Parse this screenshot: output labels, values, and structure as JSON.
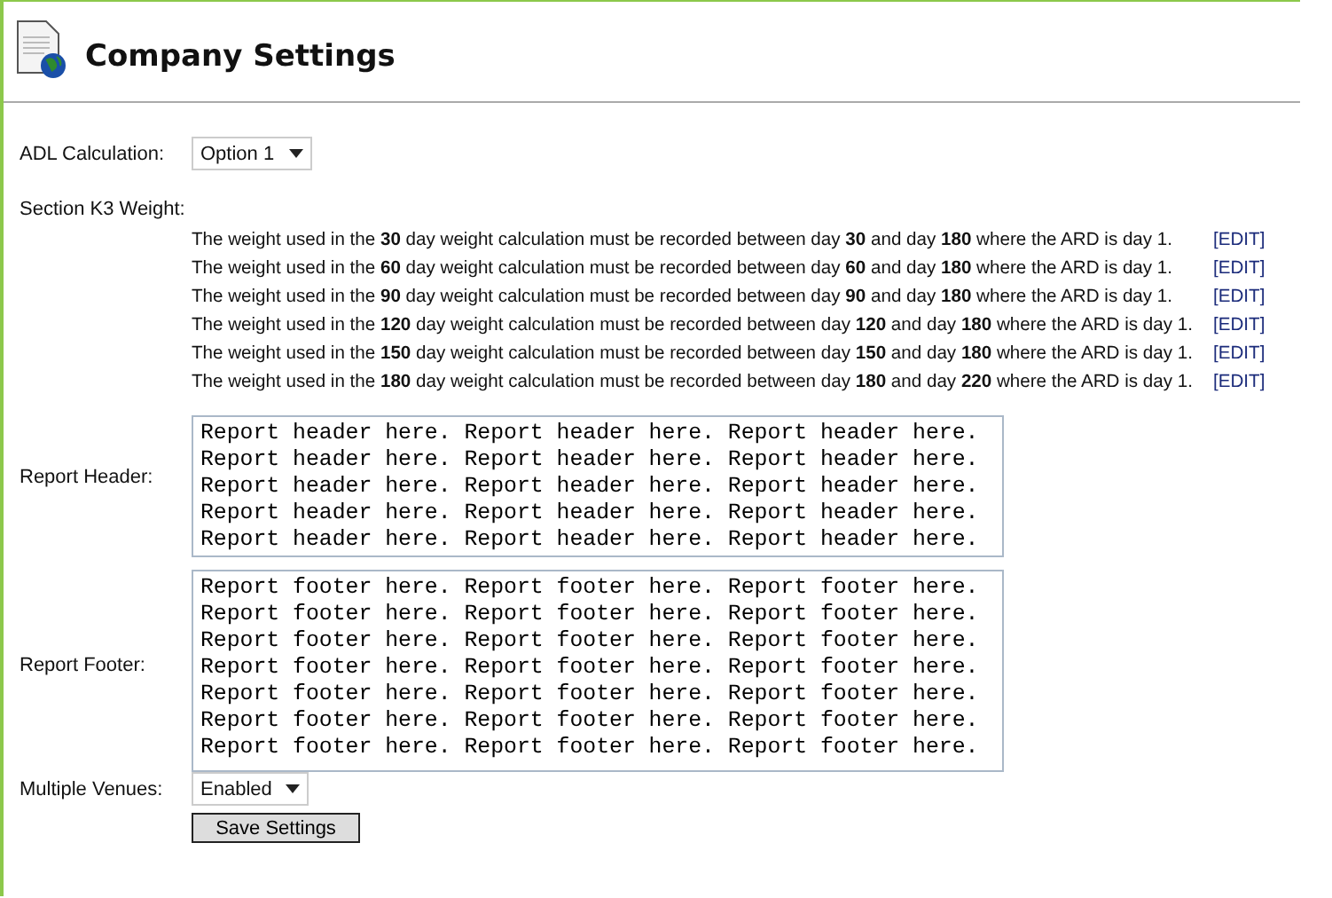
{
  "page": {
    "title": "Company Settings"
  },
  "adl_calculation": {
    "label": "ADL Calculation:",
    "value": "Option 1"
  },
  "section_k3_weight": {
    "label": "Section K3 Weight:",
    "rules": [
      {
        "text": "The weight used in the **30** day weight calculation must be recorded between day **30** and day **180** where the ARD is day 1.",
        "link": "[EDIT]"
      },
      {
        "text": "The weight used in the **60** day weight calculation must be recorded between day **60** and day **180** where the ARD is day 1.",
        "link": "[EDIT]"
      },
      {
        "text": "The weight used in the **90** day weight calculation must be recorded between day **90** and day **180** where the ARD is day 1.",
        "link": "[EDIT]"
      },
      {
        "text": "The weight used in the **120** day weight calculation must be recorded between day **120** and day **180** where the ARD is day 1.",
        "link": "[EDIT]"
      },
      {
        "text": "The weight used in the **150** day weight calculation must be recorded between day **150** and day **180** where the ARD is day 1.",
        "link": "[EDIT]"
      },
      {
        "text": "The weight used in the **180** day weight calculation must be recorded between day **180** and day **220** where the ARD is day 1.",
        "link": "[EDIT]"
      }
    ]
  },
  "report_header": {
    "label": "Report Header:",
    "value": "Report header here. Report header here. Report header here.\nReport header here. Report header here. Report header here.\nReport header here. Report header here. Report header here.\nReport header here. Report header here. Report header here.\nReport header here. Report header here. Report header here."
  },
  "report_footer": {
    "label": "Report Footer:",
    "value": "Report footer here. Report footer here. Report footer here.\nReport footer here. Report footer here. Report footer here.\nReport footer here. Report footer here. Report footer here.\nReport footer here. Report footer here. Report footer here.\nReport footer here. Report footer here. Report footer here.\nReport footer here. Report footer here. Report footer here.\nReport footer here. Report footer here. Report footer here."
  },
  "multiple_venues": {
    "label": "Multiple Venues:",
    "value": "Enabled"
  },
  "save_button": {
    "label": "Save Settings"
  }
}
